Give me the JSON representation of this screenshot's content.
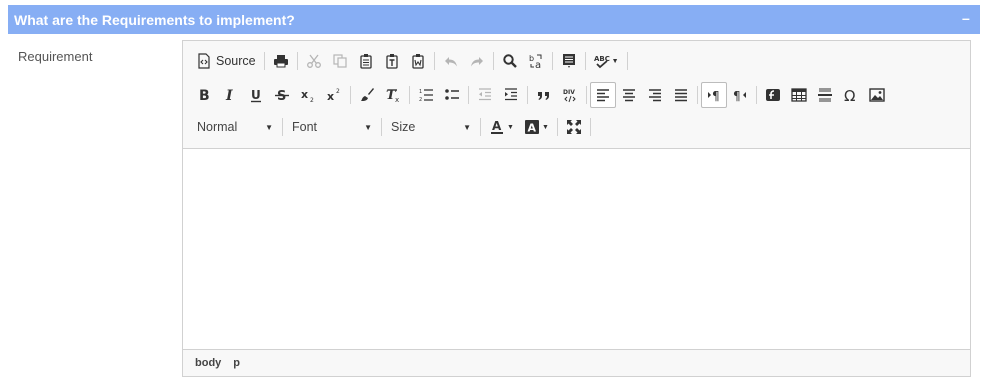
{
  "panel": {
    "title": "What are the Requirements to implement?",
    "collapse_symbol": "–"
  },
  "field": {
    "label": "Requirement"
  },
  "toolbar": {
    "source_label": "Source",
    "format_combo": "Normal",
    "font_combo": "Font",
    "size_combo": "Size",
    "combo_arrow": "▼",
    "caret": "▼"
  },
  "statusbar": {
    "path": [
      "body",
      "p"
    ]
  },
  "colors": {
    "header_bg": "#87aef4",
    "toolbar_bg": "#f8f8f8",
    "border": "#d1d1d1"
  }
}
